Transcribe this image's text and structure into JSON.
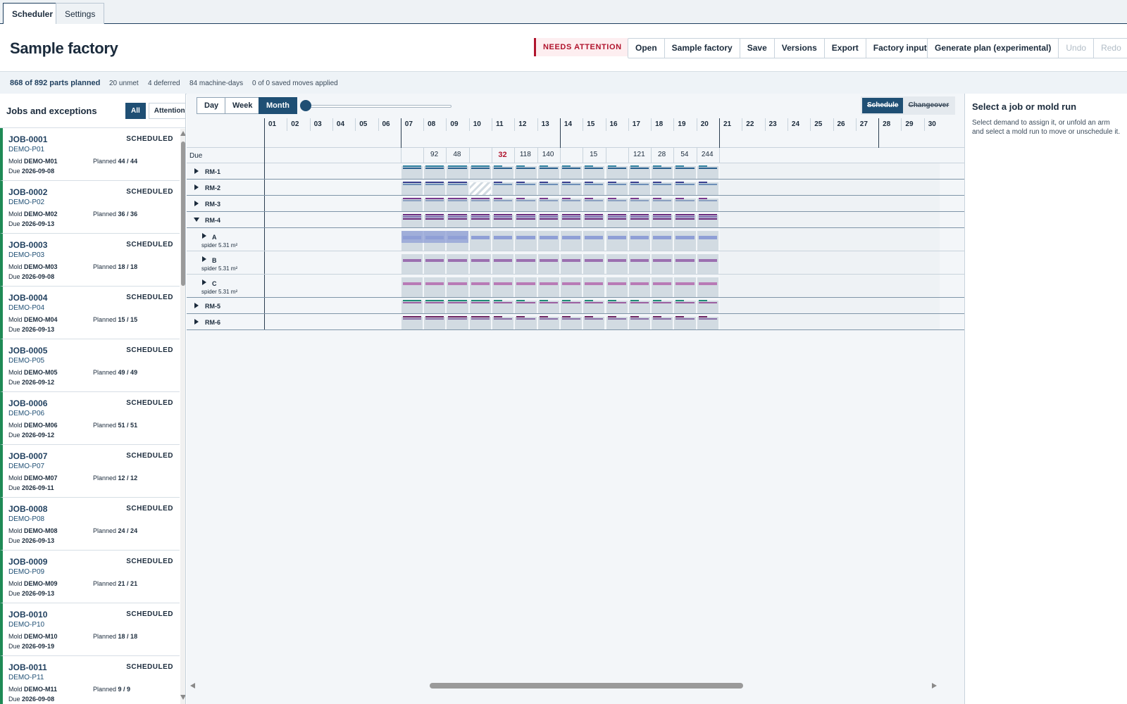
{
  "tabs": [
    {
      "label": "Scheduler",
      "active": true
    },
    {
      "label": "Settings",
      "active": false
    }
  ],
  "header": {
    "title": "Sample factory",
    "status_badge": "NEEDS ATTENTION",
    "file_actions": [
      "Open",
      "Sample factory",
      "Save",
      "Versions",
      "Export",
      "Factory inputs"
    ],
    "plan_actions": {
      "generate": "Generate plan (experimental)",
      "undo": "Undo",
      "redo": "Redo"
    }
  },
  "stats": {
    "planned": "868 of 892 parts planned",
    "unmet": "20 unmet",
    "deferred": "4 deferred",
    "machine_days": "84 machine-days",
    "moves": "0 of 0 saved moves applied"
  },
  "sidebar": {
    "title": "Jobs and exceptions",
    "filters": {
      "all": "All",
      "attention": "Attention"
    },
    "labels": {
      "mold": "Mold",
      "planned": "Planned",
      "due": "Due"
    },
    "jobs": [
      {
        "id": "JOB-0001",
        "status": "SCHEDULED",
        "part": "DEMO-P01",
        "mold": "DEMO-M01",
        "planned": "44 / 44",
        "due": "2026-09-08"
      },
      {
        "id": "JOB-0002",
        "status": "SCHEDULED",
        "part": "DEMO-P02",
        "mold": "DEMO-M02",
        "planned": "36 / 36",
        "due": "2026-09-13"
      },
      {
        "id": "JOB-0003",
        "status": "SCHEDULED",
        "part": "DEMO-P03",
        "mold": "DEMO-M03",
        "planned": "18 / 18",
        "due": "2026-09-08"
      },
      {
        "id": "JOB-0004",
        "status": "SCHEDULED",
        "part": "DEMO-P04",
        "mold": "DEMO-M04",
        "planned": "15 / 15",
        "due": "2026-09-13"
      },
      {
        "id": "JOB-0005",
        "status": "SCHEDULED",
        "part": "DEMO-P05",
        "mold": "DEMO-M05",
        "planned": "49 / 49",
        "due": "2026-09-12"
      },
      {
        "id": "JOB-0006",
        "status": "SCHEDULED",
        "part": "DEMO-P06",
        "mold": "DEMO-M06",
        "planned": "51 / 51",
        "due": "2026-09-12"
      },
      {
        "id": "JOB-0007",
        "status": "SCHEDULED",
        "part": "DEMO-P07",
        "mold": "DEMO-M07",
        "planned": "12 / 12",
        "due": "2026-09-11"
      },
      {
        "id": "JOB-0008",
        "status": "SCHEDULED",
        "part": "DEMO-P08",
        "mold": "DEMO-M08",
        "planned": "24 / 24",
        "due": "2026-09-13"
      },
      {
        "id": "JOB-0009",
        "status": "SCHEDULED",
        "part": "DEMO-P09",
        "mold": "DEMO-M09",
        "planned": "21 / 21",
        "due": "2026-09-13"
      },
      {
        "id": "JOB-0010",
        "status": "SCHEDULED",
        "part": "DEMO-P10",
        "mold": "DEMO-M10",
        "planned": "18 / 18",
        "due": "2026-09-19"
      },
      {
        "id": "JOB-0011",
        "status": "SCHEDULED",
        "part": "DEMO-P11",
        "mold": "DEMO-M11",
        "planned": "9 / 9",
        "due": "2026-09-08"
      }
    ]
  },
  "timeline": {
    "views": [
      "Day",
      "Week",
      "Month"
    ],
    "active_view": "Month",
    "modes": {
      "schedule": "Schedule",
      "changeover": "Changeover"
    },
    "days": [
      "01",
      "02",
      "03",
      "04",
      "05",
      "06",
      "07",
      "08",
      "09",
      "10",
      "11",
      "12",
      "13",
      "14",
      "15",
      "16",
      "17",
      "18",
      "19",
      "20",
      "21",
      "22",
      "23",
      "24",
      "25",
      "26",
      "27",
      "28",
      "29",
      "30"
    ],
    "due_label": "Due",
    "due_values": [
      {
        "day": "08",
        "value": "92"
      },
      {
        "day": "09",
        "value": "48"
      },
      {
        "day": "11",
        "value": "32",
        "alert": true
      },
      {
        "day": "12",
        "value": "118"
      },
      {
        "day": "13",
        "value": "140"
      },
      {
        "day": "15",
        "value": "15"
      },
      {
        "day": "17",
        "value": "121"
      },
      {
        "day": "18",
        "value": "28"
      },
      {
        "day": "19",
        "value": "54"
      },
      {
        "day": "20",
        "value": "244"
      }
    ],
    "machines": [
      {
        "name": "RM-1",
        "expanded": false,
        "colors": [
          "#2a7f9e",
          "#2a5f8e"
        ]
      },
      {
        "name": "RM-2",
        "expanded": false,
        "colors": [
          "#3a3f8e",
          "#6c8fb8"
        ]
      },
      {
        "name": "RM-3",
        "expanded": false,
        "colors": [
          "#7a3a8e",
          "#8a9fc0"
        ]
      },
      {
        "name": "RM-4",
        "expanded": true,
        "colors": [
          "#6a2a7e",
          "#7b6cb0"
        ],
        "arms": [
          {
            "name": "A",
            "detail": "spider 5.31 m²",
            "color": "#8f9fd6"
          },
          {
            "name": "B",
            "detail": "spider 5.31 m²",
            "color": "#9b6fb0"
          },
          {
            "name": "C",
            "detail": "spider 5.31 m²",
            "color": "#b87ab6"
          }
        ]
      },
      {
        "name": "RM-5",
        "expanded": false,
        "colors": [
          "#1f8a75",
          "#9b5fa0"
        ]
      },
      {
        "name": "RM-6",
        "expanded": false,
        "colors": [
          "#6a1f5e",
          "#8a6fa8"
        ]
      }
    ]
  },
  "details": {
    "title": "Select a job or mold run",
    "body": "Select demand to assign it, or unfold an arm and select a mold run to move or unschedule it."
  }
}
